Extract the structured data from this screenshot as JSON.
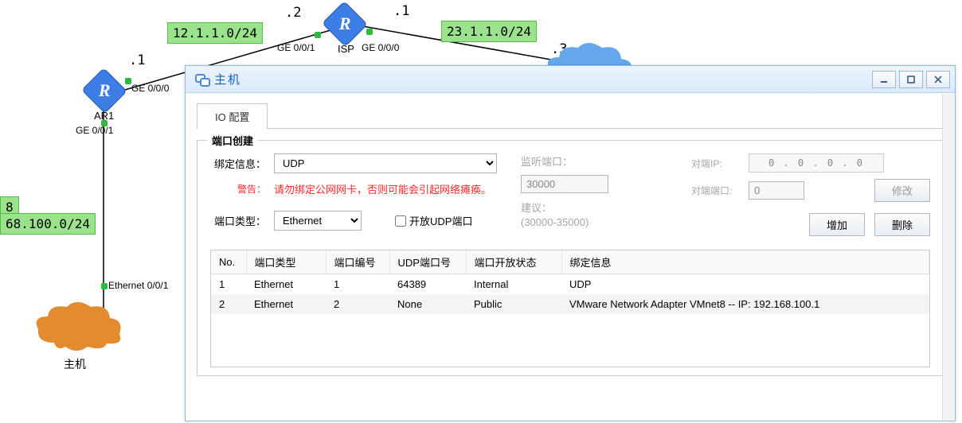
{
  "topology": {
    "nets": {
      "left": "12.1.1.0/24",
      "right": "23.1.1.0/24",
      "lan": "68.100.0/24",
      "lan_top": "8"
    },
    "octets": {
      "ar1": ".1",
      "isp_left": ".2",
      "isp_right": ".1",
      "cloud": ".3"
    },
    "nodes": {
      "ar1": {
        "label": "AR1"
      },
      "isp": {
        "label": "ISP"
      },
      "host": {
        "label": "主机"
      }
    },
    "ports": {
      "ar1_ge000": "GE 0/0/0",
      "ar1_ge001": "GE 0/0/1",
      "isp_ge001": "GE 0/0/1",
      "isp_ge000": "GE 0/0/0",
      "host_eth": "Ethernet 0/0/1"
    }
  },
  "dialog": {
    "title": "主机",
    "tab": "IO 配置",
    "group_title": "端口创建",
    "labels": {
      "bind": "绑定信息：",
      "warn_label": "警告：",
      "warn_text": "请勿绑定公网网卡，否则可能会引起网络瘫痪。",
      "port_type": "端口类型：",
      "open_udp": "开放UDP端口",
      "listen": "监听端口：",
      "suggest": "建议：",
      "suggest_range": "(30000-35000)",
      "peer_ip": "对端IP:",
      "peer_port": "对端端口:"
    },
    "values": {
      "bind_select": "UDP",
      "port_type_select": "Ethernet",
      "listen_port": "30000",
      "peer_ip_display": "0   .   0   .   0   .   0",
      "peer_port": "0"
    },
    "buttons": {
      "modify": "修改",
      "add": "增加",
      "delete": "删除"
    },
    "table": {
      "headers": {
        "no": "No.",
        "type": "端口类型",
        "num": "端口编号",
        "udp": "UDP端口号",
        "state": "端口开放状态",
        "bind": "绑定信息"
      },
      "rows": [
        {
          "no": "1",
          "type": "Ethernet",
          "num": "1",
          "udp": "64389",
          "state": "Internal",
          "bind": "UDP"
        },
        {
          "no": "2",
          "type": "Ethernet",
          "num": "2",
          "udp": "None",
          "state": "Public",
          "bind": "VMware Network Adapter VMnet8 -- IP: 192.168.100.1"
        }
      ]
    }
  }
}
